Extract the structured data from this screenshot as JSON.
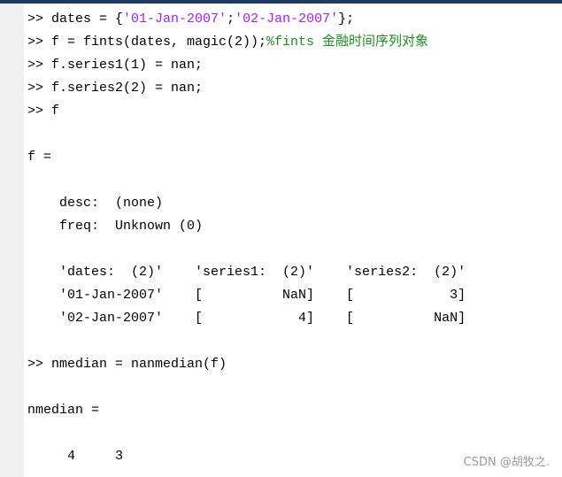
{
  "colors": {
    "text": "#000000",
    "string": "#a020f0",
    "comment": "#228b22",
    "gutter": "#f0f0f0",
    "topbar": "#1f3a5f"
  },
  "command_window": {
    "lines": [
      [
        {
          "t": ">> dates = {",
          "k": "code"
        },
        {
          "t": "'01-Jan-2007'",
          "k": "str"
        },
        {
          "t": ";",
          "k": "code"
        },
        {
          "t": "'02-Jan-2007'",
          "k": "str"
        },
        {
          "t": "};",
          "k": "code"
        }
      ],
      [
        {
          "t": ">> f = fints(dates, magic(2));",
          "k": "code"
        },
        {
          "t": "%fints 金融时间序列对象",
          "k": "cmt"
        }
      ],
      [
        {
          "t": ">> f.series1(1) = nan;",
          "k": "code"
        }
      ],
      [
        {
          "t": ">> f.series2(2) = nan;",
          "k": "code"
        }
      ],
      [
        {
          "t": ">> f",
          "k": "code"
        }
      ],
      [],
      [
        {
          "t": "f =",
          "k": "out"
        }
      ],
      [],
      [
        {
          "t": "    desc:  (none)",
          "k": "out"
        }
      ],
      [
        {
          "t": "    freq:  Unknown (0)",
          "k": "out"
        }
      ],
      [],
      [
        {
          "t": "    'dates:  (2)'    'series1:  (2)'    'series2:  (2)'",
          "k": "out"
        }
      ],
      [
        {
          "t": "    '01-Jan-2007'    [          NaN]    [            3]",
          "k": "out"
        }
      ],
      [
        {
          "t": "    '02-Jan-2007'    [            4]    [          NaN]",
          "k": "out"
        }
      ],
      [],
      [
        {
          "t": ">> nmedian = nanmedian(f)",
          "k": "code"
        }
      ],
      [],
      [
        {
          "t": "nmedian =",
          "k": "out"
        }
      ],
      [],
      [
        {
          "t": "     4     3",
          "k": "out"
        }
      ]
    ]
  },
  "watermark": "CSDN @胡牧之."
}
